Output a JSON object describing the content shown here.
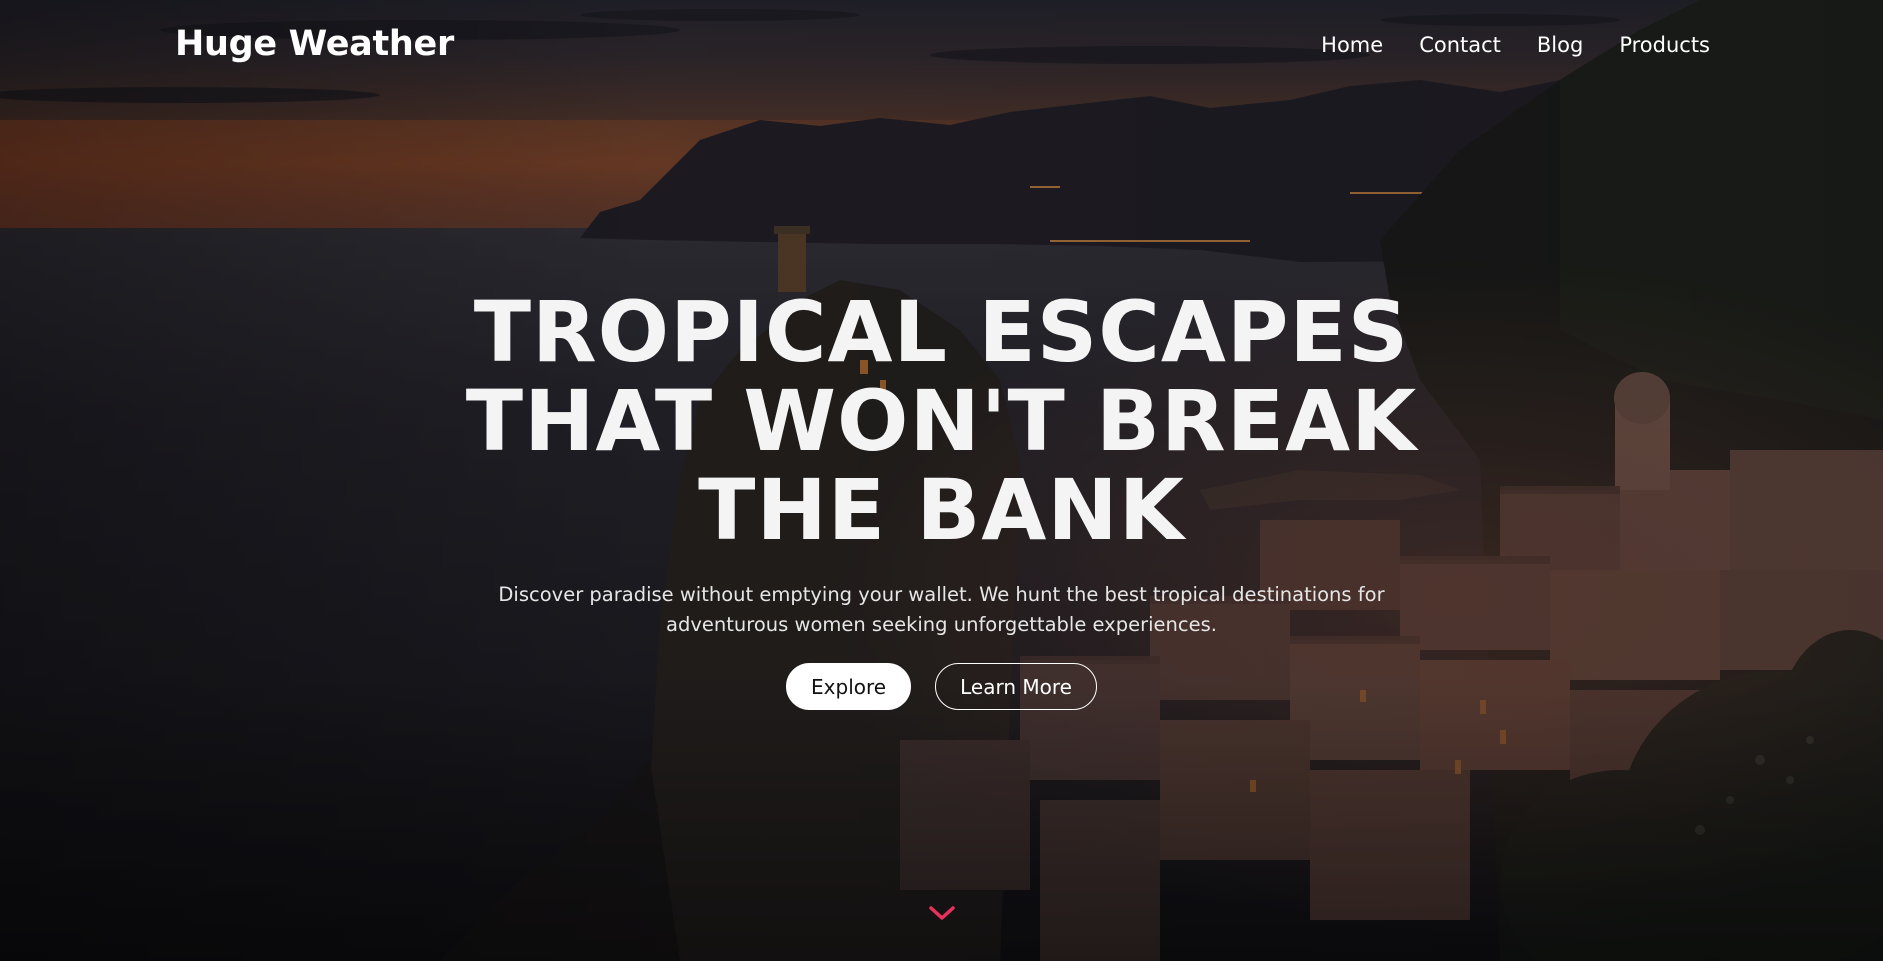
{
  "nav": {
    "brand": "Huge Weather",
    "links": [
      {
        "label": "Home"
      },
      {
        "label": "Contact"
      },
      {
        "label": "Blog"
      },
      {
        "label": "Products"
      }
    ]
  },
  "hero": {
    "headline_lines": [
      "TROPICAL ESCAPES",
      "THAT WON'T BREAK",
      "THE BANK"
    ],
    "subtitle_lines": [
      "Discover paradise without emptying your wallet. We hunt the best tropical destinations for",
      "adventurous women seeking unforgettable experiences."
    ],
    "buttons": {
      "explore": "Explore",
      "learn_more": "Learn More"
    },
    "scroll_icon": "chevron-down-icon"
  },
  "colors": {
    "accent": "#e8325a",
    "text": "#ffffff",
    "sky_top": "#2a2a35",
    "sunset": "#b8602e",
    "sea": "#201f27"
  }
}
